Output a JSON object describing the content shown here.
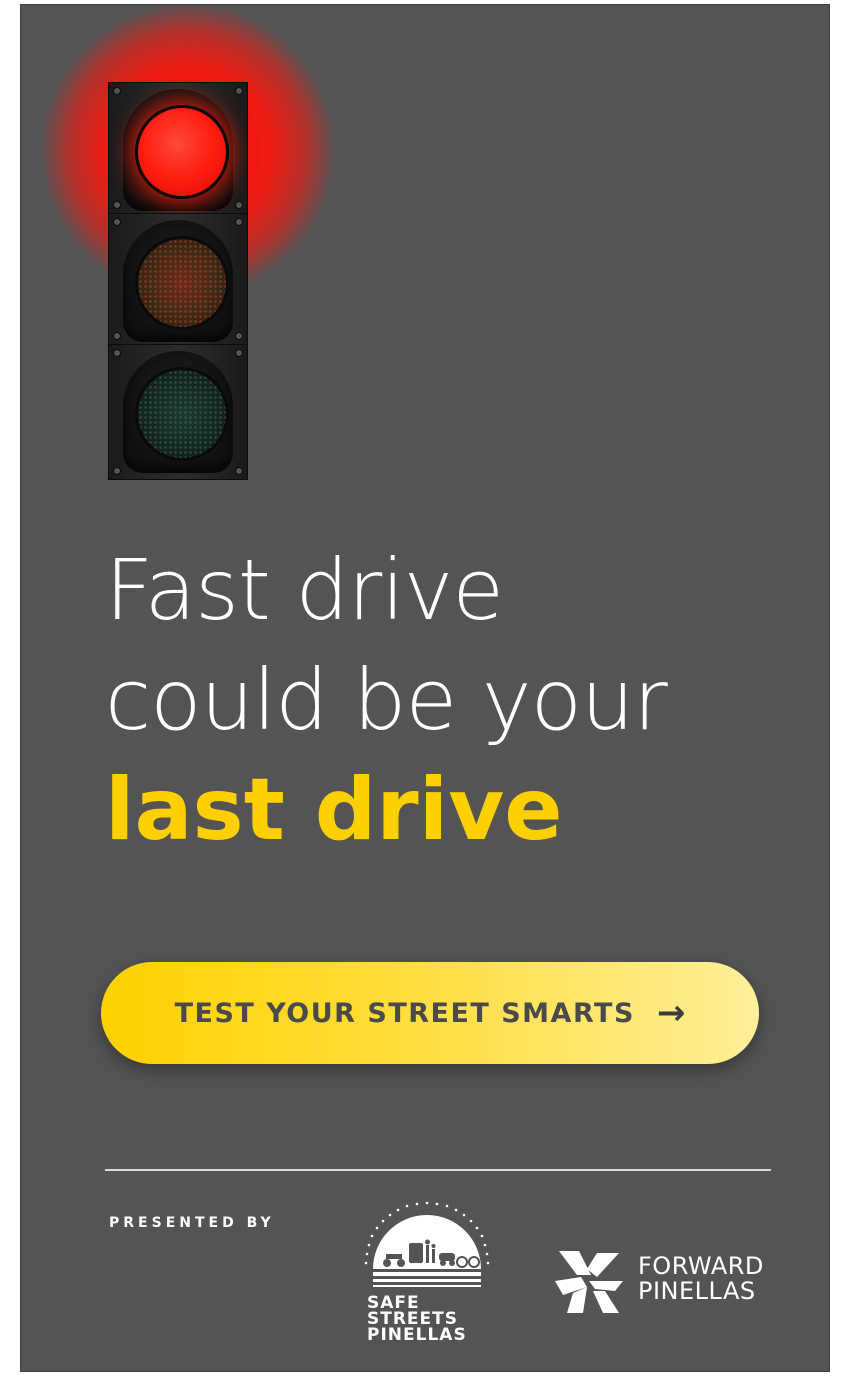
{
  "headline": {
    "line1": "Fast drive",
    "line2": "could be your",
    "accent": "last drive"
  },
  "cta": {
    "label": "TEST YOUR STREET SMARTS",
    "arrow": "→"
  },
  "footer": {
    "presented_by": "PRESENTED BY",
    "sponsor_1": {
      "lines": [
        "SAFE",
        "STREETS",
        "PINELLAS"
      ]
    },
    "sponsor_2": {
      "lines": [
        "FORWARD",
        "PINELLAS"
      ]
    }
  },
  "colors": {
    "background": "#545454",
    "accent": "#ffd000",
    "red_light": "#ff1d10"
  },
  "icons": [
    "traffic-light-icon",
    "safe-streets-pinellas-logo",
    "forward-pinellas-logo",
    "arrow-right-icon"
  ]
}
